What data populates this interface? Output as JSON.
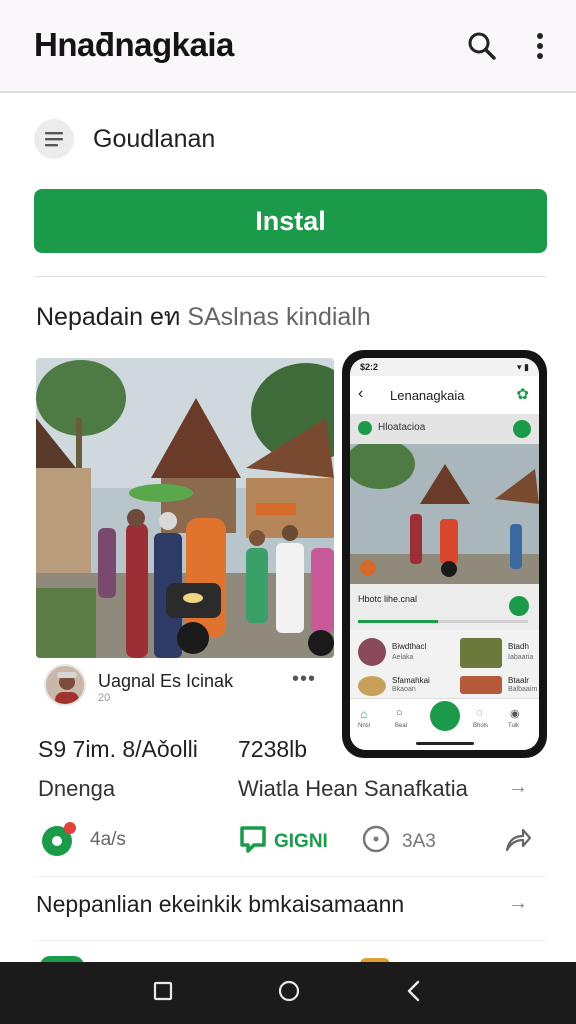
{
  "app_bar": {
    "title": "Hnaƌnagkaia"
  },
  "developer": {
    "name": "Goudlanan"
  },
  "install": {
    "label": "Instal"
  },
  "section": {
    "title_dark": "Nepadain eท",
    "title_light": "SAslnas kindialh"
  },
  "post": {
    "author": "Uagnal Es Icinak",
    "author_sub": "20"
  },
  "phone": {
    "status_time": "$2:2",
    "title": "Lenanagkaia",
    "subtitle": "Hloatacioa",
    "card_text": "Hbotc lihe.cnal",
    "list": [
      {
        "title": "Biwdthacl",
        "sub": "Aelaka"
      },
      {
        "title": "Sfamahkai",
        "sub": "Bkaoan"
      }
    ],
    "right_list": [
      {
        "title": "Btadh",
        "sub": "Iabaaria"
      },
      {
        "title": "Btaalr",
        "sub": "Balbaaim"
      }
    ],
    "nav": [
      "Nnsl",
      "Beal",
      "",
      "Bhols",
      "Tuik"
    ]
  },
  "stats": {
    "left": "S9 7im. 8/Aǒolli",
    "right": "7238lb"
  },
  "info": {
    "left": "Dnenga",
    "right": "Wiatla Hean Sanafkatia"
  },
  "actions": {
    "a1": "4a/s",
    "a2": "GIGNI",
    "a3": "3A3"
  },
  "footer": {
    "text": "Neppanlian ekeinkik bmkaisamaann"
  },
  "colors": {
    "accent": "#1b9a4a",
    "appbar": "#fbf6f9"
  }
}
